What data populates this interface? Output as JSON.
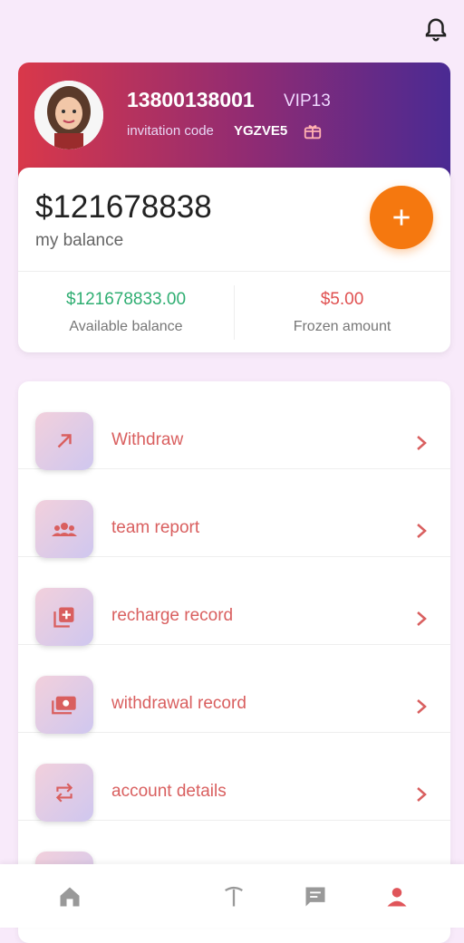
{
  "header": {
    "bell_icon": "bell-icon"
  },
  "profile": {
    "phone": "13800138001",
    "vip": "VIP13",
    "invite_label": "invitation code",
    "invite_code": "YGZVE5",
    "gift_icon": "gift-icon"
  },
  "balance": {
    "amount": "$121678838",
    "label": "my balance",
    "add_icon": "plus-icon",
    "available_value": "$121678833.00",
    "available_label": "Available balance",
    "frozen_value": "$5.00",
    "frozen_label": "Frozen amount"
  },
  "menu": {
    "items": [
      {
        "label": "Withdraw",
        "icon": "arrow-up-right-icon"
      },
      {
        "label": "team report",
        "icon": "team-icon"
      },
      {
        "label": "recharge record",
        "icon": "add-record-icon"
      },
      {
        "label": "withdrawal record",
        "icon": "money-icon"
      },
      {
        "label": "account details",
        "icon": "swap-icon"
      }
    ]
  },
  "tabbar": {
    "tabs": [
      {
        "name": "home",
        "icon": "home-icon"
      },
      {
        "name": "task",
        "icon": "task-icon"
      },
      {
        "name": "message",
        "icon": "message-icon"
      },
      {
        "name": "profile",
        "icon": "user-icon",
        "active": true
      }
    ]
  },
  "colors": {
    "accent_orange": "#f5780f",
    "green": "#2fae72",
    "red": "#e05050",
    "menu_text": "#d95f5f"
  }
}
